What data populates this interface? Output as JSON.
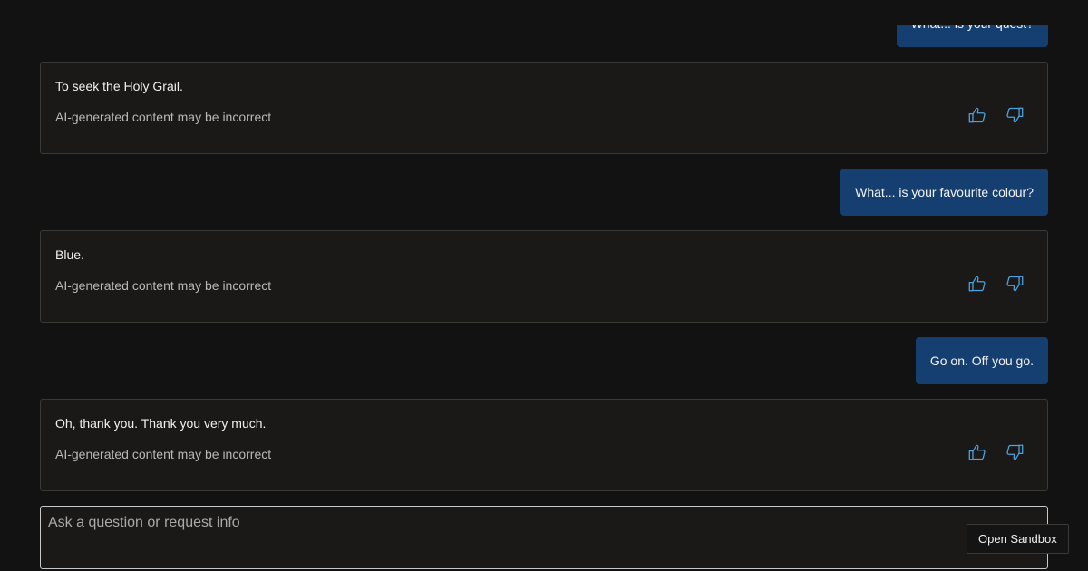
{
  "conversation": {
    "messages": [
      {
        "role": "user",
        "text": "What... is your quest?"
      },
      {
        "role": "ai",
        "text": "To seek the Holy Grail.",
        "disclaimer": "AI-generated content may be incorrect"
      },
      {
        "role": "user",
        "text": "What... is your favourite colour?"
      },
      {
        "role": "ai",
        "text": "Blue.",
        "disclaimer": "AI-generated content may be incorrect"
      },
      {
        "role": "user",
        "text": "Go on. Off you go."
      },
      {
        "role": "ai",
        "text": "Oh, thank you. Thank you very much.",
        "disclaimer": "AI-generated content may be incorrect"
      }
    ],
    "feedback_icons": [
      "thumbs-up-icon",
      "thumbs-down-icon"
    ]
  },
  "composer": {
    "placeholder": "Ask a question or request info",
    "value": ""
  },
  "sandbox_button": {
    "label": "Open Sandbox"
  },
  "colors": {
    "background": "#121212",
    "user_bubble": "#143f70",
    "card": "#1a1918",
    "feedback_icon": "#4aa3df"
  }
}
